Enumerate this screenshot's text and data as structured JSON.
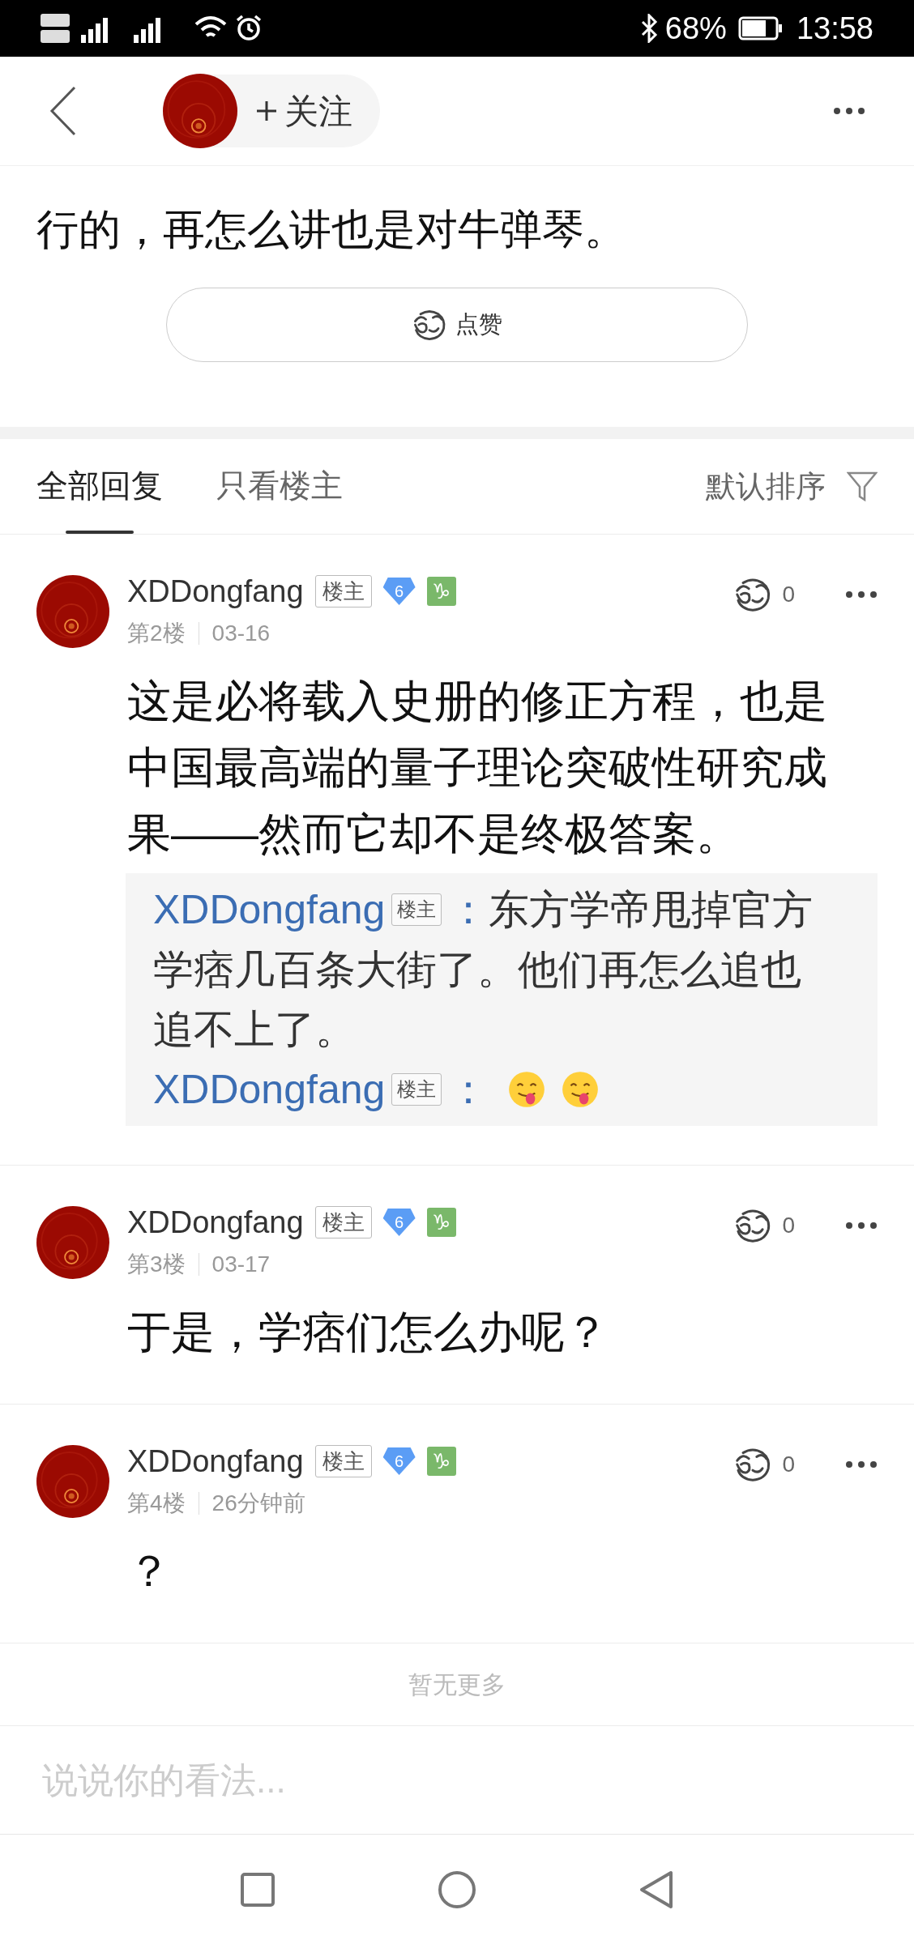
{
  "status_bar": {
    "battery": "68%",
    "time": "13:58"
  },
  "header": {
    "follow_button": "关注"
  },
  "post": {
    "text_tail": "行的，再怎么讲也是对牛弹琴。",
    "like_button": "点赞"
  },
  "tabs": [
    {
      "label": "全部回复",
      "selected": true
    },
    {
      "label": "只看楼主",
      "selected": false
    }
  ],
  "sort": "默认排序",
  "replies": [
    {
      "author": "XDDongfang",
      "op_badge": "楼主",
      "level": "6",
      "zodiac": "♑",
      "floor": "第2楼",
      "time": "03-16",
      "likes": "0",
      "content": "这是必将载入史册的修正方程，也是中国最高端的量子理论突破性研究成果——然而它却不是终极答案。",
      "quotes": [
        {
          "author": "XDDongfang",
          "badge": "楼主",
          "separator": "：",
          "kind": "text",
          "text_first_line": "东方学帝甩掉官方",
          "text_rest": "学痞几百条大街了。他们再怎么追也追不上了。"
        },
        {
          "author": "XDDongfang",
          "badge": "楼主",
          "separator": "：",
          "kind": "emoji",
          "emojis": [
            {
              "kind": "smile"
            },
            {
              "kind": "smile"
            }
          ]
        }
      ]
    },
    {
      "author": "XDDongfang",
      "op_badge": "楼主",
      "level": "6",
      "zodiac": "♑",
      "floor": "第3楼",
      "time": "03-17",
      "likes": "0",
      "content": "于是，学痞们怎么办呢？"
    },
    {
      "author": "XDDongfang",
      "op_badge": "楼主",
      "level": "6",
      "zodiac": "♑",
      "floor": "第4楼",
      "time": "26分钟前",
      "likes": "0",
      "content": "？"
    }
  ],
  "end_text": "暂无更多",
  "comment_input": {
    "placeholder": "说说你的看法..."
  }
}
